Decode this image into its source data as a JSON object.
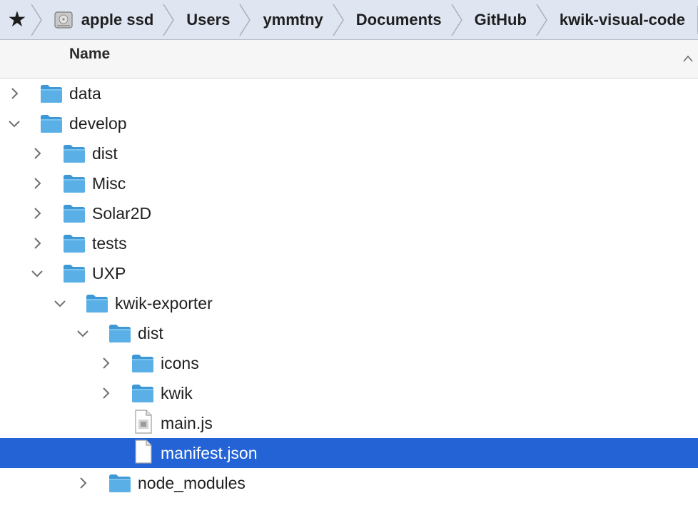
{
  "path_bar": {
    "favorite_glyph": "★",
    "crumbs": [
      "apple ssd",
      "Users",
      "ymmtny",
      "Documents",
      "GitHub",
      "kwik-visual-code"
    ]
  },
  "column_header": {
    "name_label": "Name",
    "sort_icon": "chevron-up-icon"
  },
  "colors": {
    "path_bar_bg": "#dfe5f1",
    "selection": "#2363d6",
    "folder": "#5ab0e6"
  },
  "tree": [
    {
      "label": "data",
      "level": 0,
      "type": "folder",
      "expanded": false
    },
    {
      "label": "develop",
      "level": 0,
      "type": "folder",
      "expanded": true
    },
    {
      "label": "dist",
      "level": 1,
      "type": "folder",
      "expanded": false
    },
    {
      "label": "Misc",
      "level": 1,
      "type": "folder",
      "expanded": false
    },
    {
      "label": "Solar2D",
      "level": 1,
      "type": "folder",
      "expanded": false
    },
    {
      "label": "tests",
      "level": 1,
      "type": "folder",
      "expanded": false
    },
    {
      "label": "UXP",
      "level": 1,
      "type": "folder",
      "expanded": true
    },
    {
      "label": "kwik-exporter",
      "level": 2,
      "type": "folder",
      "expanded": true
    },
    {
      "label": "dist",
      "level": 3,
      "type": "folder",
      "expanded": true
    },
    {
      "label": "icons",
      "level": 4,
      "type": "folder",
      "expanded": false
    },
    {
      "label": "kwik",
      "level": 4,
      "type": "folder",
      "expanded": false
    },
    {
      "label": "main.js",
      "level": 4,
      "type": "file-js"
    },
    {
      "label": "manifest.json",
      "level": 4,
      "type": "file",
      "selected": true
    },
    {
      "label": "node_modules",
      "level": 3,
      "type": "folder",
      "expanded": false
    }
  ]
}
